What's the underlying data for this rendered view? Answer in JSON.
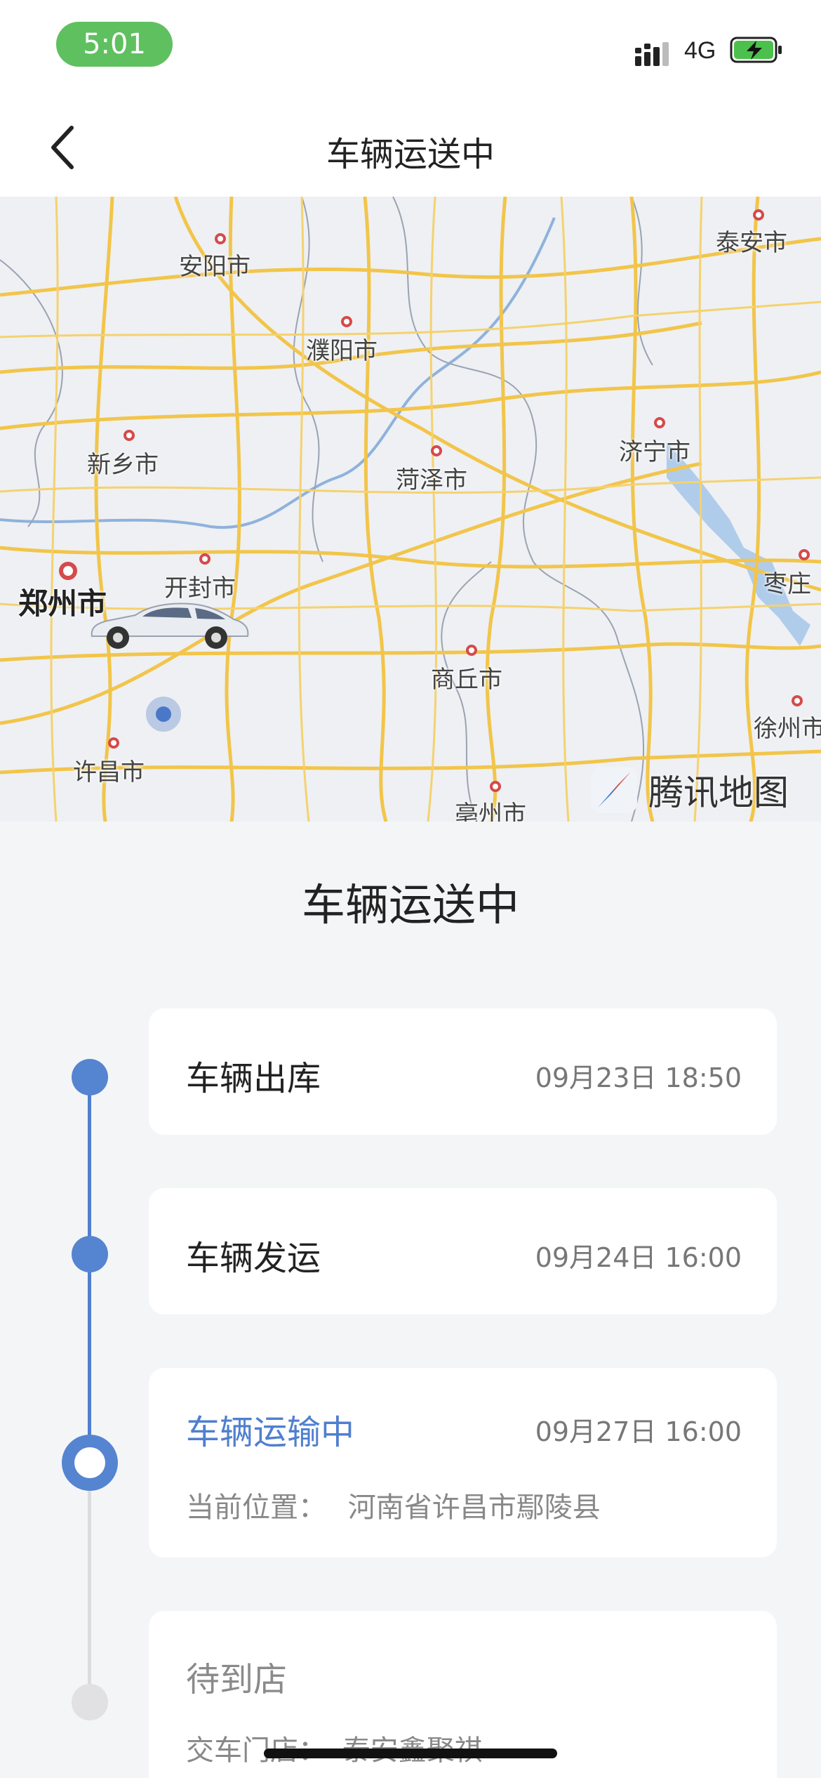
{
  "status_bar": {
    "time": "5:01",
    "network": "4G"
  },
  "nav": {
    "title": "车辆运送中",
    "back_icon": "chevron-left-icon"
  },
  "map": {
    "cities": [
      "泰安市",
      "安阳市",
      "濮阳市",
      "新乡市",
      "菏泽市",
      "济宁市",
      "郑州市",
      "开封市",
      "枣庄",
      "商丘市",
      "徐州市",
      "许昌市",
      "亳州市"
    ],
    "provider": "腾讯地图"
  },
  "section_title": "车辆运送中",
  "timeline": [
    {
      "title": "车辆出库",
      "time": "09月23日 18:50",
      "status": "done"
    },
    {
      "title": "车辆发运",
      "time": "09月24日 16:00",
      "status": "done"
    },
    {
      "title": "车辆运输中",
      "time": "09月27日 16:00",
      "status": "current",
      "sub_label": "当前位置：",
      "sub_value": "河南省许昌市鄢陵县"
    },
    {
      "title": "待到店",
      "status": "pending",
      "sub_label": "交车门店：",
      "sub_value": "泰安鑫聚祺"
    }
  ],
  "colors": {
    "accent": "#4f7fcf",
    "status_green": "#5fc05f",
    "road": "#f3c74a"
  }
}
